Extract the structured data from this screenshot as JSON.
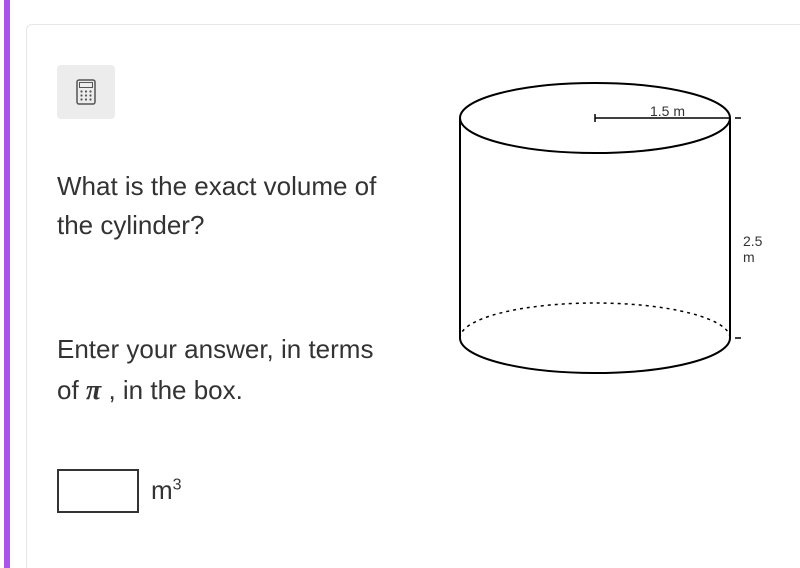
{
  "question": "What is the exact volume of the cylinder?",
  "instruction_pre": "Enter your answer, in terms of ",
  "instruction_pi": "π",
  "instruction_post": " , in the box.",
  "unit_base": "m",
  "unit_exp": "3",
  "cylinder": {
    "radius_label": "1.5 m",
    "height_label": "2.5 m"
  },
  "answer_value": ""
}
